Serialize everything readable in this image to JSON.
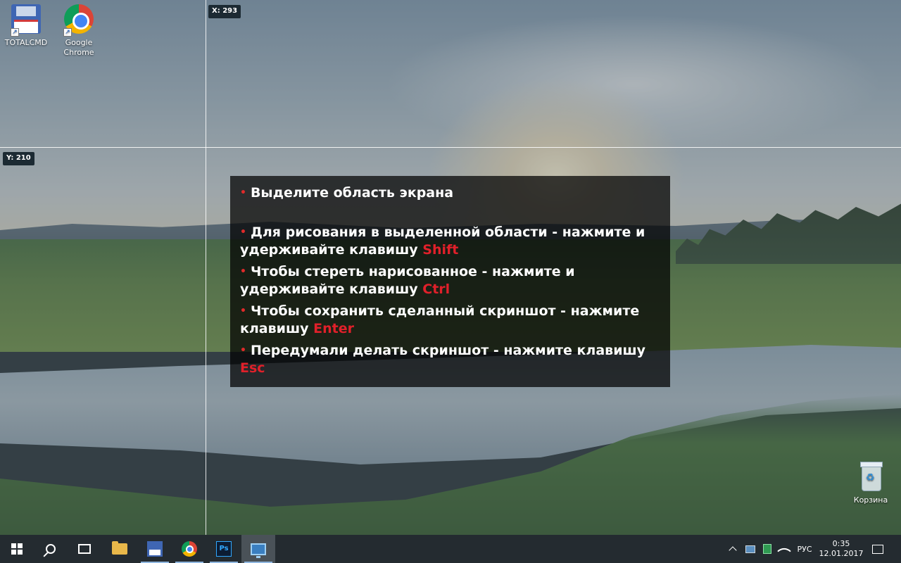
{
  "overlay": {
    "x_readout": "X: 293",
    "y_readout": "Y: 210"
  },
  "desktop": {
    "icons": [
      {
        "label": "TOTALCMD",
        "icon": "floppy-disk-icon"
      },
      {
        "label": "Google Chrome",
        "icon": "chrome-icon"
      },
      {
        "label": "Корзина",
        "icon": "recycle-bin-icon"
      }
    ]
  },
  "instructions": {
    "bullet": "•",
    "items": [
      {
        "text": "Выделите область экрана",
        "key": ""
      },
      {
        "text": "Для рисования в выделенной области - нажмите и удерживайте клавишу ",
        "key": "Shift"
      },
      {
        "text": "Чтобы стереть нарисованное - нажмите и удерживайте клавишу ",
        "key": "Ctrl"
      },
      {
        "text": "Чтобы сохранить сделанный скриншот - нажмите клавишу ",
        "key": "Enter"
      },
      {
        "text": "Передумали делать скриншот - нажмите клавишу ",
        "key": "Esc"
      }
    ],
    "key_color": "#e0202a"
  },
  "taskbar": {
    "buttons": [
      {
        "icon": "windows-start-icon"
      },
      {
        "icon": "search-icon"
      },
      {
        "icon": "task-view-icon"
      },
      {
        "icon": "file-explorer-icon"
      },
      {
        "icon": "total-commander-icon"
      },
      {
        "icon": "chrome-icon"
      },
      {
        "icon": "photoshop-icon",
        "text": "Ps"
      },
      {
        "icon": "screenshot-tool-icon"
      }
    ],
    "tray": {
      "language": "РУС",
      "time": "0:35",
      "date": "12.01.2017"
    }
  }
}
